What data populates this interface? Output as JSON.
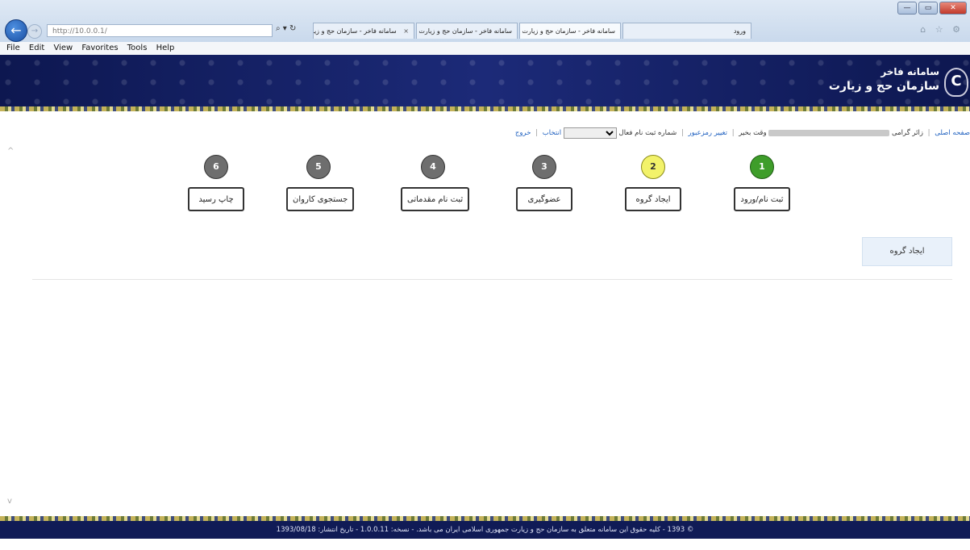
{
  "browser": {
    "address": "http://10.0.0.1/",
    "address_tools": "⌕ ▾ ↻",
    "tabs": [
      {
        "label": "سامانه فاخر - سازمان حج و زیارت",
        "active": true
      },
      {
        "label": "سامانه فاخر - سازمان حج و زیارت",
        "active": false
      },
      {
        "label": "سامانه فاخر - سازمان حج و زیارت",
        "active": false
      },
      {
        "label": "ورود",
        "active": false
      }
    ],
    "menu": [
      "File",
      "Edit",
      "View",
      "Favorites",
      "Tools",
      "Help"
    ],
    "window_buttons": {
      "minimize": "—",
      "maximize": "▭",
      "close": "✕"
    },
    "tool_icons": "⌂ ☆ ⚙"
  },
  "header": {
    "title_line1": "سامانه فاخر",
    "title_line2": "سازمان حج و زیارت",
    "logo": "C"
  },
  "userbar": {
    "home": "صفحه اصلی",
    "greeting": "زائر گرامی",
    "time_label": "وقت بخیر",
    "change_password": "تغییر رمزعبور",
    "registration_label": "شماره ثبت نام فعال",
    "select_label": "انتخاب",
    "logout": "خروج"
  },
  "steps": [
    {
      "number": "1",
      "label": "ثبت نام/ورود",
      "state": "done"
    },
    {
      "number": "2",
      "label": "ایجاد گروه",
      "state": "current"
    },
    {
      "number": "3",
      "label": "عضوگیری",
      "state": "pending"
    },
    {
      "number": "4",
      "label": "ثبت نام مقدماتی",
      "state": "pending"
    },
    {
      "number": "5",
      "label": "جستجوی کاروان",
      "state": "pending"
    },
    {
      "number": "6",
      "label": "چاپ رسید",
      "state": "pending"
    }
  ],
  "page": {
    "heading": "ایجاد گروه"
  },
  "footer": {
    "text": "© 1393 - کلیه حقوق این سامانه متعلق به سازمان حج و زیارت جمهوری اسلامی ایران می باشد. - نسخه: 1.0.0.11 - تاریخ انتشار: 1393/08/18"
  },
  "colors": {
    "header_bg": "#101b56",
    "step_done": "#3e9d2a",
    "step_current": "#f2f26a",
    "step_pending": "#6e6e6e",
    "link": "#1d5fbf"
  }
}
